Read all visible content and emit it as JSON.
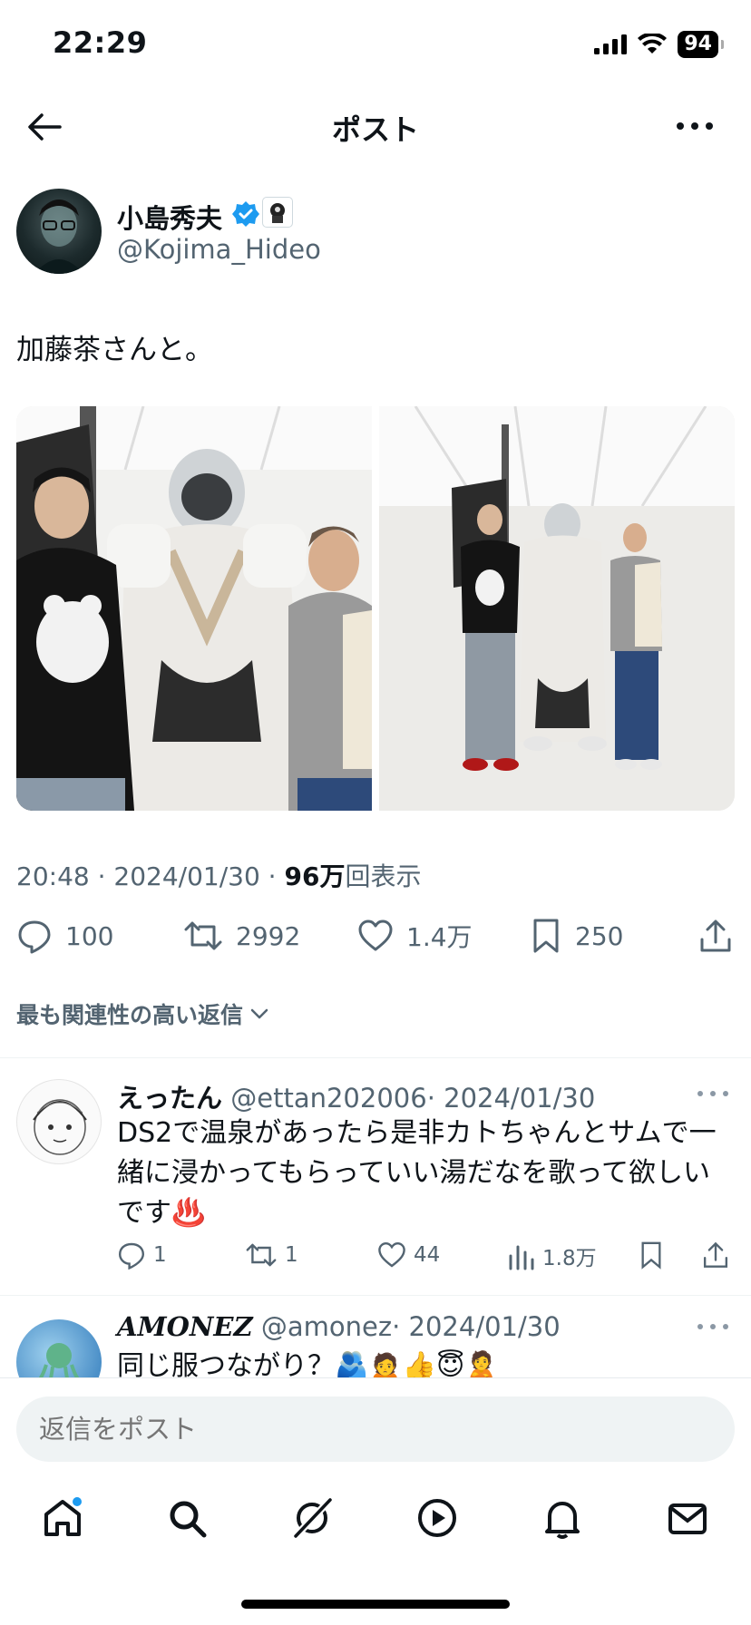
{
  "status_bar": {
    "time": "22:29",
    "battery": "94"
  },
  "header": {
    "title": "ポスト"
  },
  "author": {
    "name": "小島秀夫",
    "handle": "@Kojima_Hideo"
  },
  "tweet": {
    "text": "加藤茶さんと。",
    "time": "20:48 · 2024/01/30 · ",
    "views_count": "96万",
    "views_label": "回表示",
    "replies": "100",
    "retweets": "2992",
    "likes": "1.4万",
    "bookmarks": "250"
  },
  "sort_label": "最も関連性の高い返信",
  "replies": [
    {
      "name": "えったん",
      "handle": "@ettan202006",
      "date": "· 2024/01/30",
      "text": "DS2で温泉があったら是非カトちゃんとサムで一緒に浸かってもらっていい湯だなを歌って欲しいです♨️",
      "reply_count": "1",
      "retweet_count": "1",
      "like_count": "44",
      "view_count": "1.8万"
    },
    {
      "name": "𝑨𝑴𝑶𝑵𝑬𝒁",
      "handle": "@amonez",
      "date": "· 2024/01/30",
      "text": "同じ服つながり？🫂🙍👍😇🙎"
    }
  ],
  "compose": {
    "placeholder": "返信をポスト"
  },
  "colors": {
    "accent": "#1d9bf0",
    "text": "#0f1419",
    "secondary": "#536471"
  }
}
